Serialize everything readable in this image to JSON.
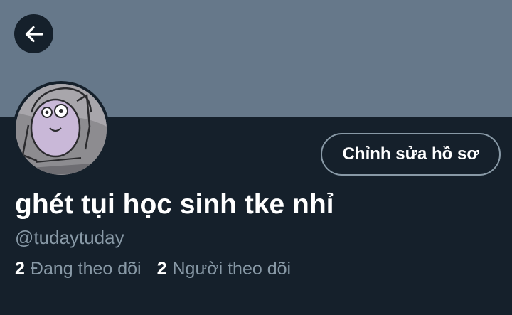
{
  "header": {
    "back_icon": "arrow-left-icon",
    "banner_color": "#66788a"
  },
  "profile": {
    "avatar_icon": "avatar-sketch-image",
    "edit_button_label": "Chỉnh sửa hồ sơ",
    "display_name": "ghét tụi học sinh tke nhỉ",
    "handle": "@tudaytuday",
    "following_count": "2",
    "following_label": "Đang theo dõi",
    "followers_count": "2",
    "followers_label": "Người theo dõi"
  },
  "colors": {
    "background": "#15202b",
    "text_primary": "#ffffff",
    "text_secondary": "#8899a6"
  }
}
